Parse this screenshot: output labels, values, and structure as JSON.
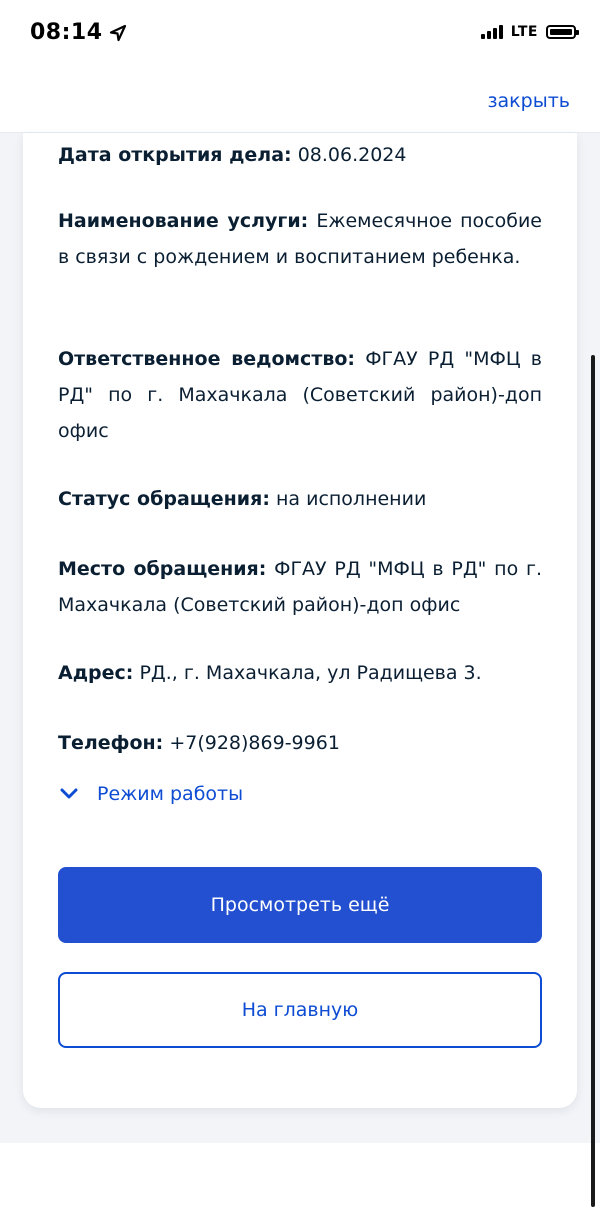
{
  "status_bar": {
    "time": "08:14",
    "network": "LTE"
  },
  "nav": {
    "close_label": "закрыть"
  },
  "case": {
    "opened": {
      "label": "Дата открытия дела:",
      "value": "08.06.2024"
    },
    "service": {
      "label": "Наименование услуги:",
      "value": "Ежемесячное пособие в связи с рождением и воспитанием ребенка."
    },
    "department": {
      "label": "Ответственное ведомство:",
      "value": "ФГАУ РД \"МФЦ в РД\" по г. Махачкала (Советский район)-доп офис"
    },
    "status": {
      "label": "Статус обращения:",
      "value": "на исполнении"
    },
    "place": {
      "label": "Место обращения:",
      "value": "ФГАУ РД \"МФЦ в РД\" по г. Махачкала (Советский район)-доп офис"
    },
    "address": {
      "label": "Адрес:",
      "value": "РД., г. Махачкала, ул Радищева 3."
    },
    "phone": {
      "label": "Телефон:",
      "value": "+7(928)869-9961"
    }
  },
  "schedule": {
    "label": "Режим работы"
  },
  "actions": {
    "view_more": "Просмотреть ещё",
    "home": "На главную"
  },
  "colors": {
    "accent": "#0d4cd3",
    "primary_button": "#2350d0",
    "text": "#0b1f33",
    "page_background": "#f2f4f8"
  }
}
